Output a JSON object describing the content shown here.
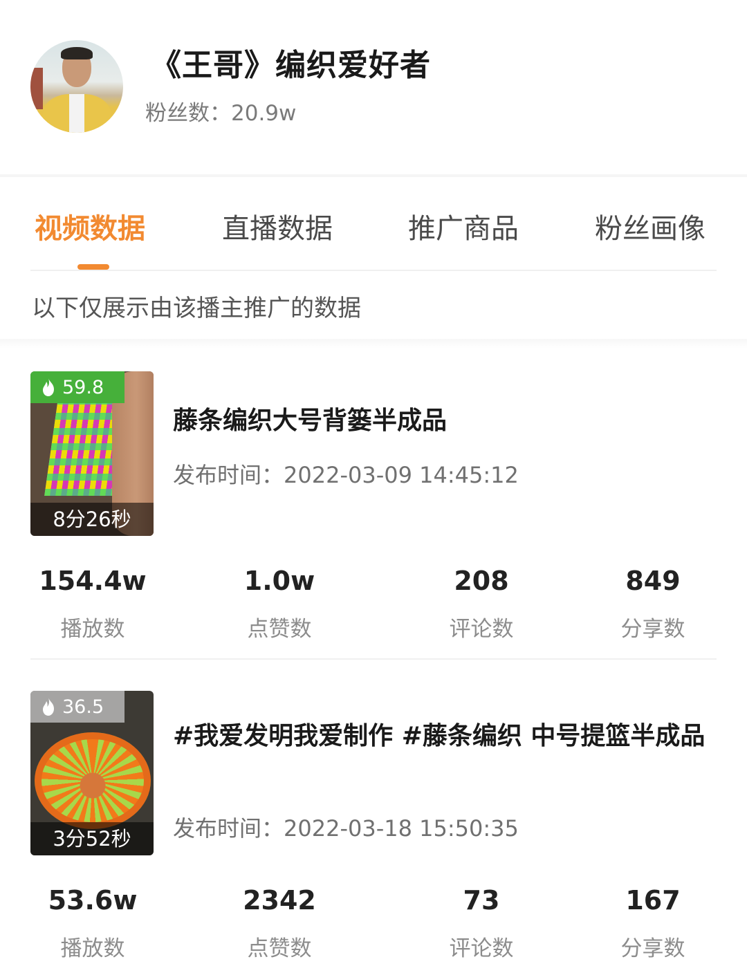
{
  "profile": {
    "name": "《王哥》编织爱好者",
    "fans": "粉丝数：20.9w"
  },
  "tabs": [
    {
      "label": "视频数据",
      "active": true
    },
    {
      "label": "直播数据",
      "active": false
    },
    {
      "label": "推广商品",
      "active": false
    },
    {
      "label": "粉丝画像",
      "active": false
    }
  ],
  "note": "以下仅展示由该播主推广的数据",
  "colors": {
    "accent": "#f28a31",
    "hot_badge": "#46b03a"
  },
  "videos": [
    {
      "heat": "59.8",
      "duration": "8分26秒",
      "title": "藤条编织大号背篓半成品",
      "publish": "发布时间：2022-03-09 14:45:12",
      "stats": [
        {
          "value": "154.4w",
          "label": "播放数"
        },
        {
          "value": "1.0w",
          "label": "点赞数"
        },
        {
          "value": "208",
          "label": "评论数"
        },
        {
          "value": "849",
          "label": "分享数"
        }
      ]
    },
    {
      "heat": "36.5",
      "duration": "3分52秒",
      "title": "#我爱发明我爱制作 #藤条编织 中号提篮半成品",
      "publish": "发布时间：2022-03-18 15:50:35",
      "stats": [
        {
          "value": "53.6w",
          "label": "播放数"
        },
        {
          "value": "2342",
          "label": "点赞数"
        },
        {
          "value": "73",
          "label": "评论数"
        },
        {
          "value": "167",
          "label": "分享数"
        }
      ]
    }
  ]
}
